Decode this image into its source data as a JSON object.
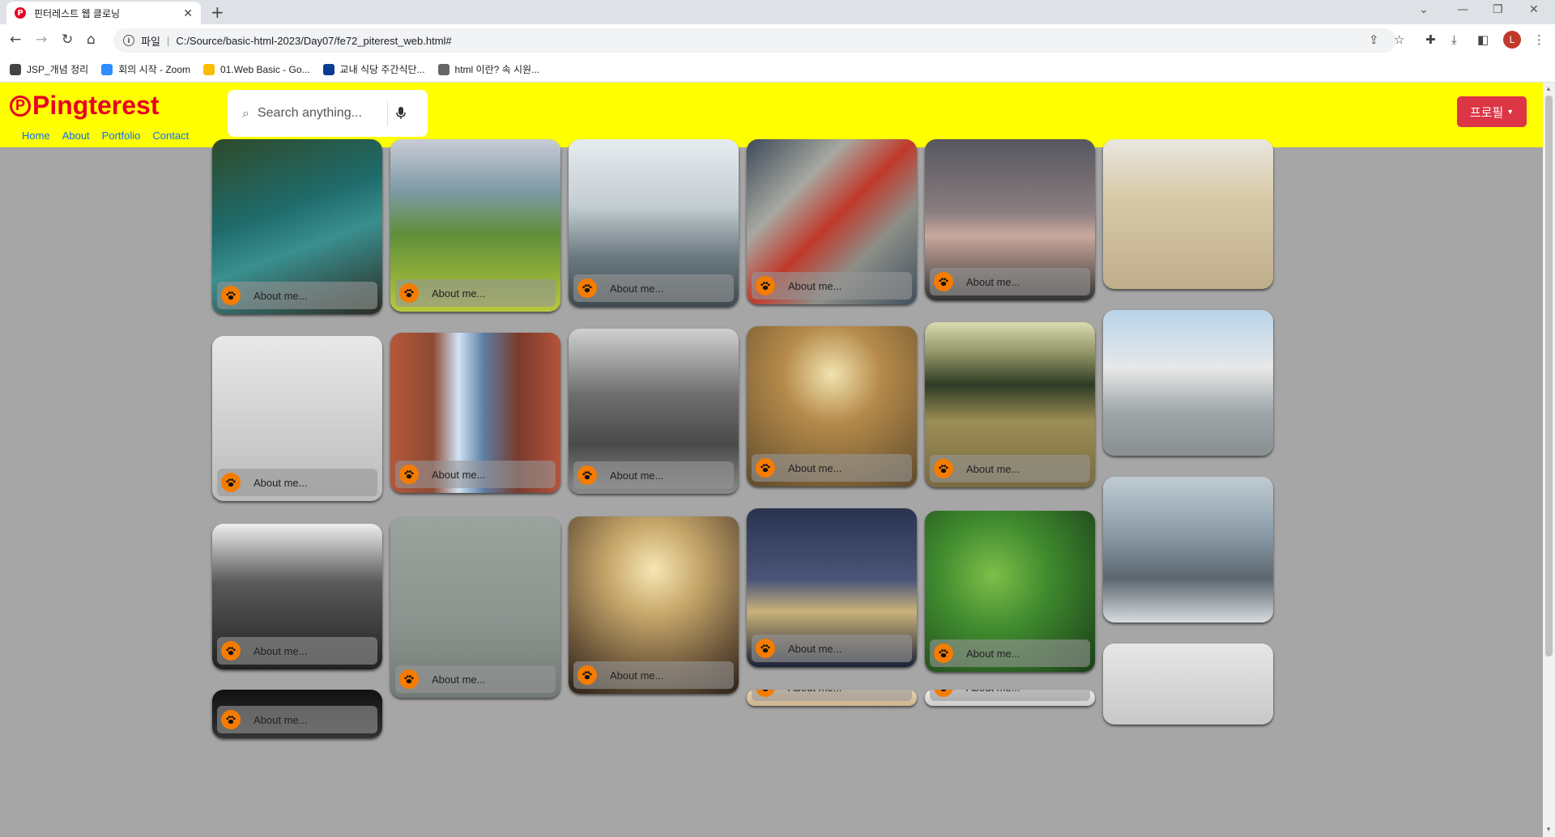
{
  "browser": {
    "tab_title": "핀터레스트 웹 클로닝",
    "favicon_letter": "P",
    "address_prefix": "파일",
    "address_url": "C:/Source/basic-html-2023/Day07/fe72_piterest_web.html#",
    "profile_initial": "L",
    "bookmarks": [
      {
        "label": "JSP_개념 정리",
        "icon": "apps-grid-icon",
        "color": "#444444"
      },
      {
        "label": "회의 시작 - Zoom",
        "icon": "zoom-icon",
        "color": "#2d8cff"
      },
      {
        "label": "01.Web Basic - Go...",
        "icon": "google-drive-icon",
        "color": "#fbbc04"
      },
      {
        "label": "교내 식당 주간식단...",
        "icon": "school-icon",
        "color": "#0a3d91"
      },
      {
        "label": "html 이란? 속 시원...",
        "icon": "pen-icon",
        "color": "#666666"
      }
    ]
  },
  "site": {
    "logo_text": "Pingterest",
    "nav": [
      "Home",
      "About",
      "Portfolio",
      "Contact"
    ],
    "search_placeholder": "Search anything...",
    "profile_button": "프로필",
    "colors": {
      "header": "#ffff00",
      "brand": "#e60023",
      "background": "#a6a6a6",
      "profile_button": "#dc3545",
      "paw": "#f57c00"
    }
  },
  "cards": [
    {
      "caption": "About me...",
      "scene": "vintage car interior with teal dashboard and steering wheel"
    },
    {
      "caption": "About me...",
      "scene": "green mountain ridge"
    },
    {
      "caption": "About me...",
      "scene": "person standing by misty lake"
    },
    {
      "caption": "About me...",
      "scene": "red fire alarm box on graffiti wall"
    },
    {
      "caption": "About me...",
      "scene": "bridge silhouette at dusk"
    },
    {
      "caption": "About me...",
      "scene": "laptop on desk"
    },
    {
      "caption": "About me...",
      "scene": "walruses on beach"
    },
    {
      "caption": "About me...",
      "scene": "bridge between brick buildings"
    },
    {
      "caption": "About me...",
      "scene": "black and white trees"
    },
    {
      "caption": "About me...",
      "scene": "sun through tall grass"
    },
    {
      "caption": "About me...",
      "scene": "meadow path with forest"
    },
    {
      "caption": "About me...",
      "scene": "airplane at airport"
    },
    {
      "caption": "About me...",
      "scene": "black and white steel tower"
    },
    {
      "caption": "About me...",
      "scene": "foggy coastline"
    },
    {
      "caption": "About me...",
      "scene": "escalator tunnel"
    },
    {
      "caption": "About me...",
      "scene": "suspension bridge at night"
    },
    {
      "caption": "About me...",
      "scene": "green leaves with buds"
    },
    {
      "caption": "About me...",
      "scene": "snowy mountain peak"
    }
  ]
}
